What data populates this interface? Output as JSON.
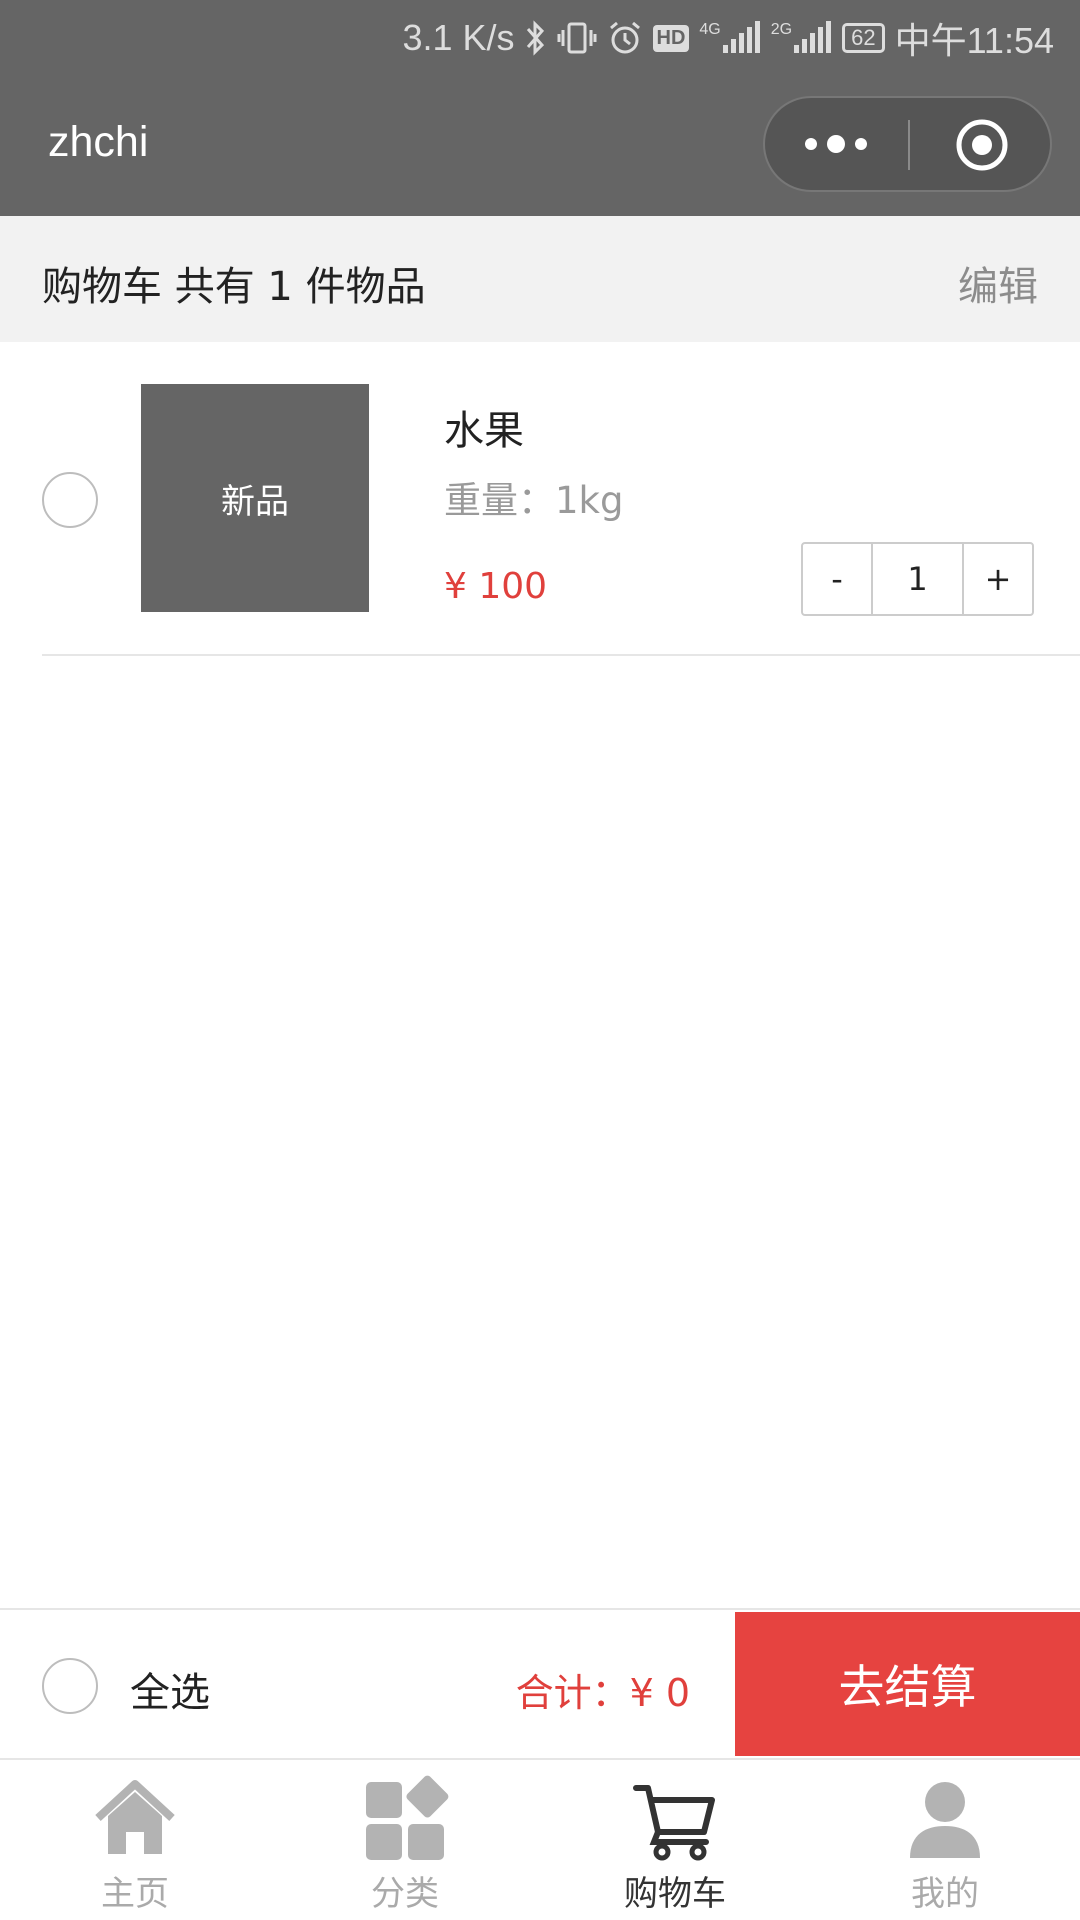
{
  "status_bar": {
    "net_speed": "3.1 K/s",
    "hd_badge": "HD",
    "net_type_1": "4G",
    "net_type_2": "2G",
    "battery": "62",
    "time": "中午11:54"
  },
  "nav": {
    "title": "zhchi",
    "more_icon": "more-dots-icon",
    "close_icon": "target-circle-icon"
  },
  "cart_header": {
    "summary": "购物车 共有 1 件物品",
    "edit_label": "编辑"
  },
  "items": [
    {
      "thumb_label": "新品",
      "name": "水果",
      "spec": "重量：1kg",
      "price": "¥ 100",
      "quantity": "1",
      "minus_label": "-",
      "plus_label": "+"
    }
  ],
  "checkout": {
    "select_all_label": "全选",
    "total": "合计：¥ 0",
    "pay_label": "去结算"
  },
  "tabbar": {
    "tabs": [
      {
        "label": "主页",
        "icon": "home-icon",
        "active": false
      },
      {
        "label": "分类",
        "icon": "category-icon",
        "active": false
      },
      {
        "label": "购物车",
        "icon": "cart-icon",
        "active": true
      },
      {
        "label": "我的",
        "icon": "person-icon",
        "active": false
      }
    ]
  },
  "colors": {
    "header_bg": "#656565",
    "accent_red": "#e64340",
    "price_red": "#e0403c"
  }
}
